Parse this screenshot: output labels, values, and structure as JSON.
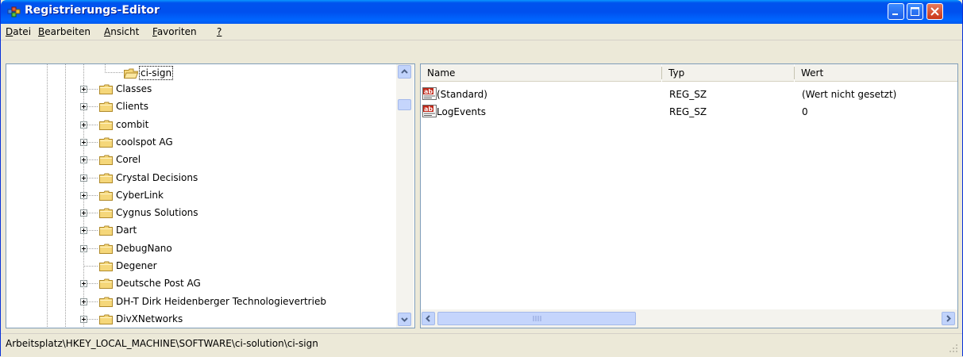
{
  "window": {
    "title": "Registrierungs-Editor",
    "buttons": {
      "minimize": "minimize-icon",
      "maximize": "maximize-icon",
      "close": "close-icon"
    }
  },
  "menu": [
    {
      "label": "Datei"
    },
    {
      "label": "Bearbeiten"
    },
    {
      "label": "Ansicht"
    },
    {
      "label": "Favoriten"
    },
    {
      "label": "?"
    }
  ],
  "tree": {
    "selected": "ci-sign",
    "items": [
      {
        "label": "ci-sign",
        "expandable": false,
        "selected": true,
        "open": true
      },
      {
        "label": "Classes",
        "expandable": true
      },
      {
        "label": "Clients",
        "expandable": true
      },
      {
        "label": "combit",
        "expandable": true
      },
      {
        "label": "coolspot AG",
        "expandable": true
      },
      {
        "label": "Corel",
        "expandable": true
      },
      {
        "label": "Crystal Decisions",
        "expandable": true
      },
      {
        "label": "CyberLink",
        "expandable": true
      },
      {
        "label": "Cygnus Solutions",
        "expandable": true
      },
      {
        "label": "Dart",
        "expandable": true
      },
      {
        "label": "DebugNano",
        "expandable": true
      },
      {
        "label": "Degener",
        "expandable": false
      },
      {
        "label": "Deutsche Post AG",
        "expandable": true
      },
      {
        "label": "DH-T Dirk Heidenberger Technologievertrieb",
        "expandable": true
      },
      {
        "label": "DivXNetworks",
        "expandable": true
      }
    ]
  },
  "list": {
    "columns": [
      {
        "label": "Name"
      },
      {
        "label": "Typ"
      },
      {
        "label": "Wert"
      }
    ],
    "rows": [
      {
        "name": "(Standard)",
        "type": "REG_SZ",
        "value": "(Wert nicht gesetzt)",
        "icon": "string-value-icon"
      },
      {
        "name": "LogEvents",
        "type": "REG_SZ",
        "value": "0",
        "icon": "string-value-icon"
      }
    ]
  },
  "statusbar": {
    "path": "Arbeitsplatz\\HKEY_LOCAL_MACHINE\\SOFTWARE\\ci-solution\\ci-sign"
  },
  "colors": {
    "titlebar": "#0054e3",
    "selection_border": "#000000",
    "folder": "#f5d77a"
  }
}
